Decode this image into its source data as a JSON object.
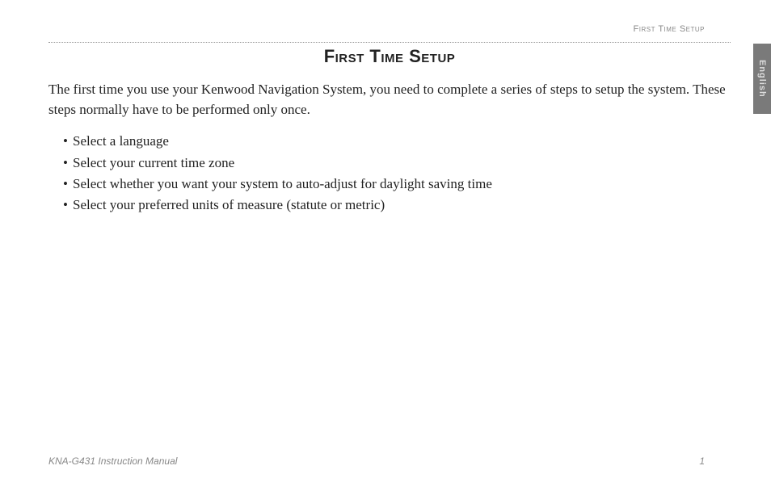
{
  "header": {
    "section_label": "First Time Setup"
  },
  "title": "First Time Setup",
  "intro": "The first time you use your Kenwood Navigation System, you need to complete a series of steps to setup the system. These steps normally have to be performed only once.",
  "bullets": [
    "Select a language",
    "Select your current time zone",
    "Select whether you want your system to auto-adjust for daylight saving time",
    "Select your preferred units of measure (statute or metric)"
  ],
  "footer": {
    "manual_name": "KNA-G431 Instruction Manual",
    "page_number": "1"
  },
  "language_tab": "English"
}
